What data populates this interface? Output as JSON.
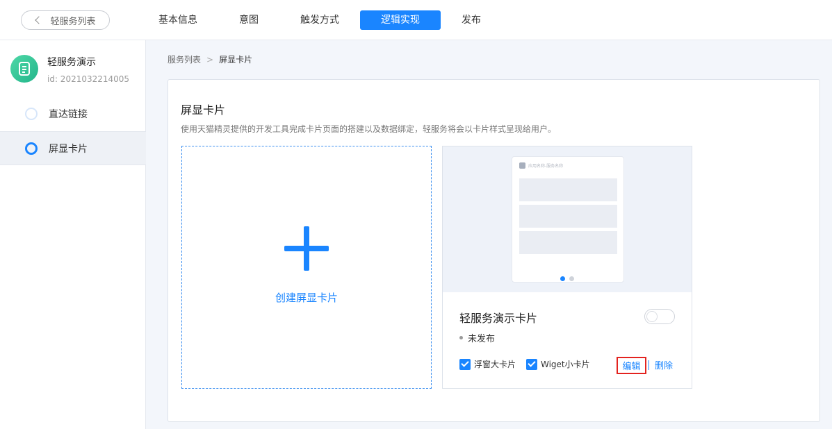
{
  "topbar": {
    "back_label": "轻服务列表",
    "tabs": [
      {
        "label": "基本信息"
      },
      {
        "label": "意图"
      },
      {
        "label": "触发方式"
      },
      {
        "label": "逻辑实现"
      },
      {
        "label": "发布"
      }
    ],
    "active_tab": "逻辑实现"
  },
  "sidebar": {
    "app_name": "轻服务演示",
    "app_id": "id: 2021032214005",
    "items": [
      {
        "label": "直达链接",
        "active": false
      },
      {
        "label": "屏显卡片",
        "active": true
      }
    ]
  },
  "breadcrumb": {
    "parent": "服务列表",
    "separator": ">",
    "current": "屏显卡片"
  },
  "panel": {
    "title": "屏显卡片",
    "description": "使用天猫精灵提供的开发工具完成卡片页面的搭建以及数据绑定，轻服务将会以卡片样式呈现给用户。"
  },
  "create_card": {
    "label": "创建屏显卡片"
  },
  "card": {
    "preview_header": "应用名称-服务名称",
    "title": "轻服务演示卡片",
    "status": "未发布",
    "toggle_on": false,
    "options": [
      {
        "label": "浮窗大卡片",
        "checked": true
      },
      {
        "label": "Wiget小卡片",
        "checked": true
      }
    ],
    "edit_label": "编辑",
    "delete_label": "删除"
  },
  "colors": {
    "accent": "#1a85ff",
    "highlight_border": "#e3231f",
    "app_icon": "#2fc597"
  }
}
